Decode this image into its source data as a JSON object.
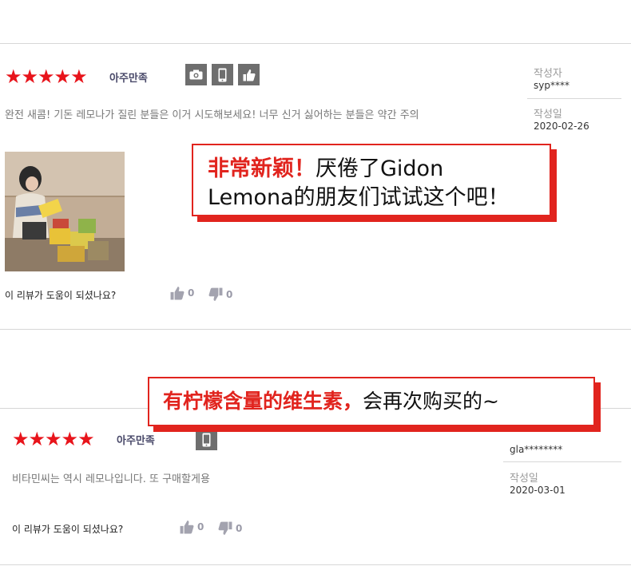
{
  "reviews": [
    {
      "rating_label": "아주만족",
      "stars": "★★★★★",
      "author_label": "작성자",
      "author": "syp****",
      "date_label": "작성일",
      "date": "2020-02-26",
      "text": "완전 새콤! 기돈 레모나가 질린 분들은 이거 시도해보세요! 너무 신거 싫어하는 분들은 약간 주의",
      "helpful_question": "이 리뷰가 도움이 되셨나요?",
      "likes": "0",
      "dislikes": "0",
      "badges": [
        "camera-icon",
        "mobile-icon",
        "thumbs-up-icon"
      ]
    },
    {
      "rating_label": "아주만족",
      "stars": "★★★★★",
      "author": "gla********",
      "date_label": "작성일",
      "date": "2020-03-01",
      "text": "비타민씨는 역시 레모나입니다. 또 구매할게용",
      "helpful_question": "이 리뷰가 도움이 되셨나요?",
      "likes": "0",
      "dislikes": "0",
      "badges": [
        "mobile-icon"
      ]
    }
  ],
  "callouts": [
    {
      "highlight": "非常新颖！",
      "line1_rest": "厌倦了Gidon",
      "line2": "Lemona的朋友们试试这个吧！"
    },
    {
      "highlight": "有柠檬含量的维生素，",
      "rest": "会再次购买的~"
    }
  ],
  "colors": {
    "accent_red": "#e1241e",
    "star_red": "#e8141b",
    "badge_gray": "#6e6e6e"
  }
}
